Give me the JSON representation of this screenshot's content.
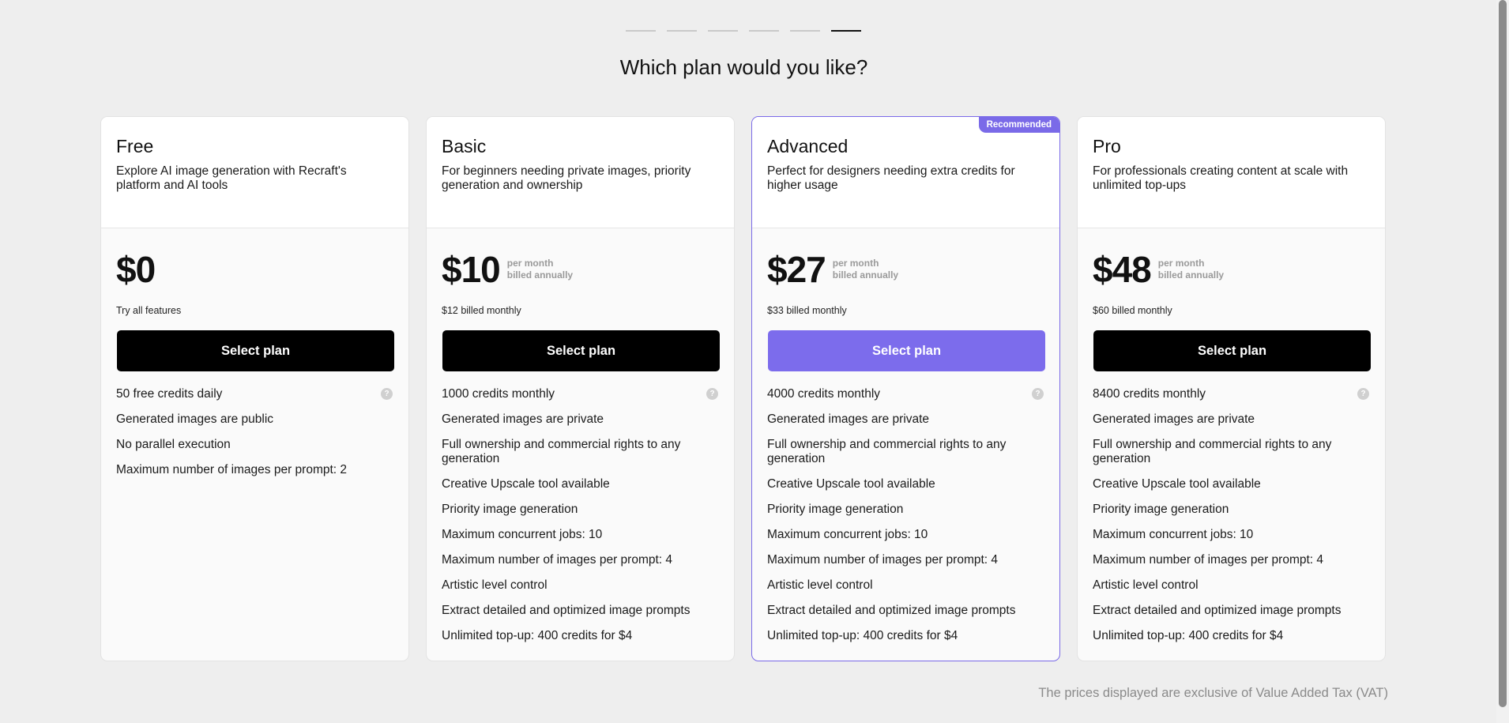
{
  "title": "Which plan would you like?",
  "steps": 6,
  "active_step": 6,
  "accent_color": "#7c6cec",
  "plans": [
    {
      "name": "Free",
      "description": "Explore AI image generation with Recraft's platform and AI tools",
      "price": "$0",
      "per_month": "",
      "billed_annually": "",
      "subprice": "Try all features",
      "button": "Select plan",
      "help_icon": "?",
      "features": [
        "50 free credits daily",
        "Generated images are public",
        "No parallel execution",
        "Maximum number of images per prompt: 2"
      ]
    },
    {
      "name": "Basic",
      "description": "For beginners needing private images, priority generation and ownership",
      "price": "$10",
      "per_month": "per month",
      "billed_annually": "billed annually",
      "subprice": "$12 billed monthly",
      "button": "Select plan",
      "help_icon": "?",
      "features": [
        "1000 credits monthly",
        "Generated images are private",
        "Full ownership and commercial rights to any generation",
        "Creative Upscale tool available",
        "Priority image generation",
        "Maximum concurrent jobs: 10",
        "Maximum number of images per prompt: 4",
        "Artistic level control",
        "Extract detailed and optimized image prompts",
        "Unlimited top-up: 400 credits for $4"
      ]
    },
    {
      "name": "Advanced",
      "badge": "Recommended",
      "description": "Perfect for designers needing extra credits for higher usage",
      "price": "$27",
      "per_month": "per month",
      "billed_annually": "billed annually",
      "subprice": "$33 billed monthly",
      "button": "Select plan",
      "help_icon": "?",
      "features": [
        "4000 credits monthly",
        "Generated images are private",
        "Full ownership and commercial rights to any generation",
        "Creative Upscale tool available",
        "Priority image generation",
        "Maximum concurrent jobs: 10",
        "Maximum number of images per prompt: 4",
        "Artistic level control",
        "Extract detailed and optimized image prompts",
        "Unlimited top-up: 400 credits for $4"
      ]
    },
    {
      "name": "Pro",
      "description": "For professionals creating content at scale with unlimited top-ups",
      "price": "$48",
      "per_month": "per month",
      "billed_annually": "billed annually",
      "subprice": "$60 billed monthly",
      "button": "Select plan",
      "help_icon": "?",
      "features": [
        "8400 credits monthly",
        "Generated images are private",
        "Full ownership and commercial rights to any generation",
        "Creative Upscale tool available",
        "Priority image generation",
        "Maximum concurrent jobs: 10",
        "Maximum number of images per prompt: 4",
        "Artistic level control",
        "Extract detailed and optimized image prompts",
        "Unlimited top-up: 400 credits for $4"
      ]
    }
  ],
  "vat_note": "The prices displayed are exclusive of Value Added Tax (VAT)"
}
